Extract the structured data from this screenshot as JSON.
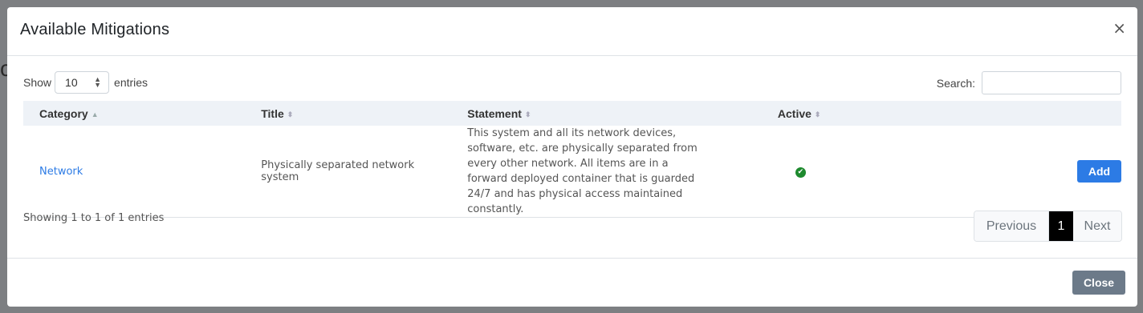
{
  "modal": {
    "title": "Available Mitigations",
    "close_x": "×",
    "footer_close_label": "Close"
  },
  "length_control": {
    "show_label": "Show",
    "selected": "10",
    "entries_label": "entries"
  },
  "search": {
    "label": "Search:",
    "value": "",
    "placeholder": ""
  },
  "table": {
    "columns": [
      {
        "label": "Category",
        "sort": "asc"
      },
      {
        "label": "Title",
        "sort": "none"
      },
      {
        "label": "Statement",
        "sort": "none"
      },
      {
        "label": "Active",
        "sort": "none"
      }
    ],
    "rows": [
      {
        "category": "Network",
        "title": "Physically separated network system",
        "statement": "This system and all its network devices, software, etc. are physically separated from every other network. All items are in a forward deployed container that is guarded 24/7 and has physical access maintained constantly.",
        "active_icon": "check-circle-icon",
        "action_label": "Add"
      }
    ]
  },
  "info": "Showing 1 to 1 of 1 entries",
  "pagination": {
    "previous_label": "Previous",
    "current_page": "1",
    "next_label": "Next"
  },
  "colors": {
    "primary": "#2c7be5",
    "active_green": "#1e8a2e",
    "secondary": "#6c7a89",
    "current_page_bg": "#000000"
  }
}
